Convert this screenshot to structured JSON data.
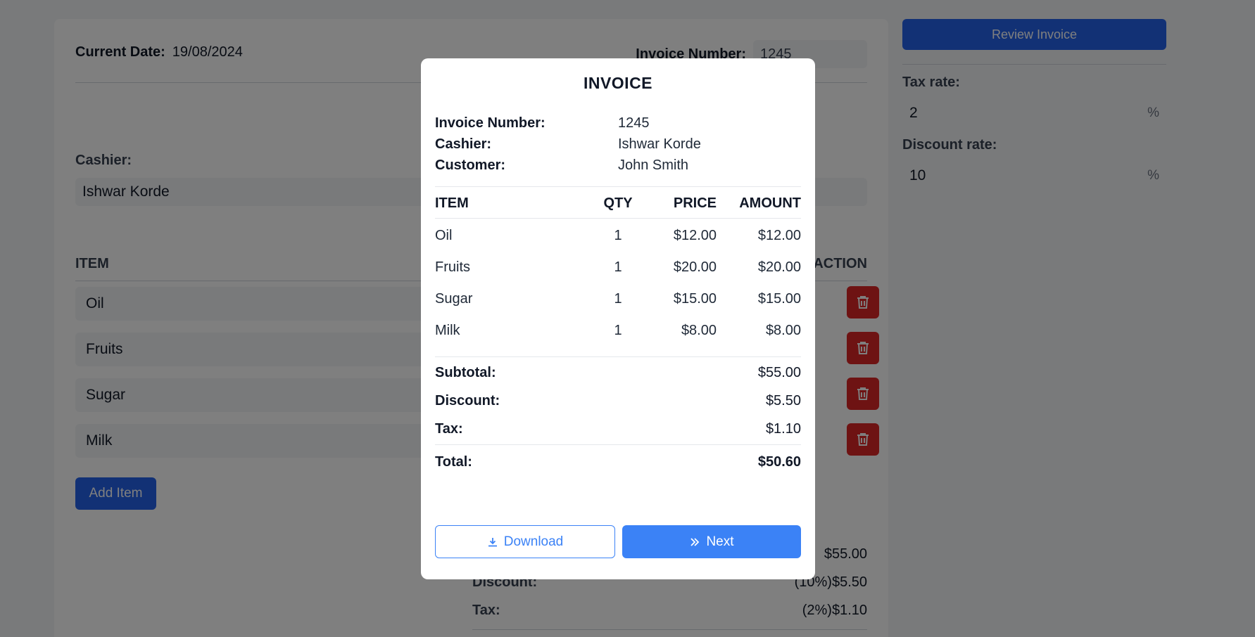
{
  "page": {
    "current_date_label": "Current Date:",
    "current_date": "19/08/2024",
    "invoice_number_label": "Invoice Number:",
    "invoice_number": "1245",
    "cashier_label": "Cashier:",
    "cashier": "Ishwar Korde",
    "item_header": "ITEM",
    "action_header": "ACTION",
    "items": [
      {
        "name": "Oil"
      },
      {
        "name": "Fruits"
      },
      {
        "name": "Sugar"
      },
      {
        "name": "Milk"
      }
    ],
    "add_item_label": "Add Item",
    "summary": {
      "subtotal_value": "$55.00",
      "discount_label": "Discount:",
      "discount_value": "(10%)$5.50",
      "tax_label": "Tax:",
      "tax_value": "(2%)$1.10"
    }
  },
  "sidebar": {
    "review_label": "Review Invoice",
    "tax_rate_label": "Tax rate:",
    "tax_rate": "2",
    "discount_rate_label": "Discount rate:",
    "discount_rate": "10",
    "percent_symbol": "%"
  },
  "modal": {
    "title": "INVOICE",
    "invoice_number_label": "Invoice Number:",
    "invoice_number": "1245",
    "cashier_label": "Cashier:",
    "cashier": "Ishwar Korde",
    "customer_label": "Customer:",
    "customer": "John Smith",
    "columns": {
      "item": "ITEM",
      "qty": "QTY",
      "price": "PRICE",
      "amount": "AMOUNT"
    },
    "rows": [
      {
        "item": "Oil",
        "qty": "1",
        "price": "$12.00",
        "amount": "$12.00"
      },
      {
        "item": "Fruits",
        "qty": "1",
        "price": "$20.00",
        "amount": "$20.00"
      },
      {
        "item": "Sugar",
        "qty": "1",
        "price": "$15.00",
        "amount": "$15.00"
      },
      {
        "item": "Milk",
        "qty": "1",
        "price": "$8.00",
        "amount": "$8.00"
      }
    ],
    "subtotal_label": "Subtotal:",
    "subtotal": "$55.00",
    "discount_label": "Discount:",
    "discount": "$5.50",
    "tax_label": "Tax:",
    "tax": "$1.10",
    "total_label": "Total:",
    "total": "$50.60",
    "download_label": "Download",
    "next_label": "Next",
    "download_icon": "download-icon",
    "next_icon": "double-chevron-right-icon"
  },
  "colors": {
    "primary": "#2563eb",
    "modal_button": "#3b82f6",
    "danger": "#dc2626"
  }
}
